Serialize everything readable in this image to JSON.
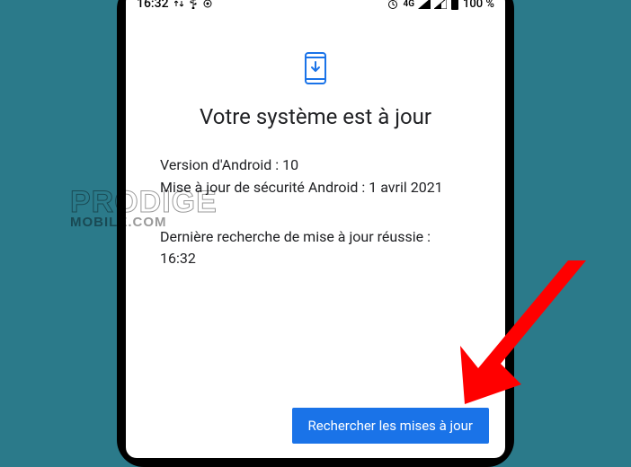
{
  "status_bar": {
    "time": "16:32",
    "network_type": "4G",
    "battery_percent": "100 %"
  },
  "content": {
    "title": "Votre système est à jour",
    "android_version_line": "Version d'Android : 10",
    "security_patch_line": "Mise à jour de sécurité Android : 1 avril 2021",
    "last_check_label": "Dernière recherche de mise à jour réussie :",
    "last_check_time": "16:32"
  },
  "button": {
    "check_updates": "Rechercher les mises à jour"
  },
  "watermark": {
    "line1": "PRODIGE",
    "line2": "MOBILE.COM"
  },
  "colors": {
    "accent": "#1a73e8",
    "background": "#2b7a8a"
  }
}
